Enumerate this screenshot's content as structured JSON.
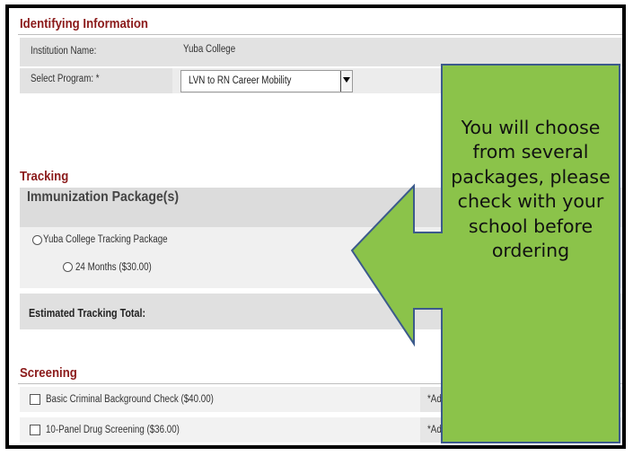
{
  "identifying": {
    "title": "Identifying Information",
    "institution_label": "Institution Name:",
    "institution_value": "Yuba College",
    "program_label": "Select Program: *",
    "program_value": "LVN to RN Career Mobility"
  },
  "tracking": {
    "title": "Tracking",
    "package_header": "Immunization Package(s)",
    "package_option": "Yuba College Tracking Package",
    "suboption": "24 Months ($30.00)",
    "total_label": "Estimated Tracking Total:"
  },
  "screening": {
    "title": "Screening",
    "items": [
      {
        "label": "Basic Criminal Background Check ($40.00)",
        "note": "*Add"
      },
      {
        "label": "10-Panel Drug Screening ($36.00)",
        "note": "*Add"
      }
    ]
  },
  "callout": {
    "text": "You will choose from several packages, please check with your school before ordering",
    "fill_color": "#8bc34a",
    "border_color": "#3c5a8c"
  }
}
